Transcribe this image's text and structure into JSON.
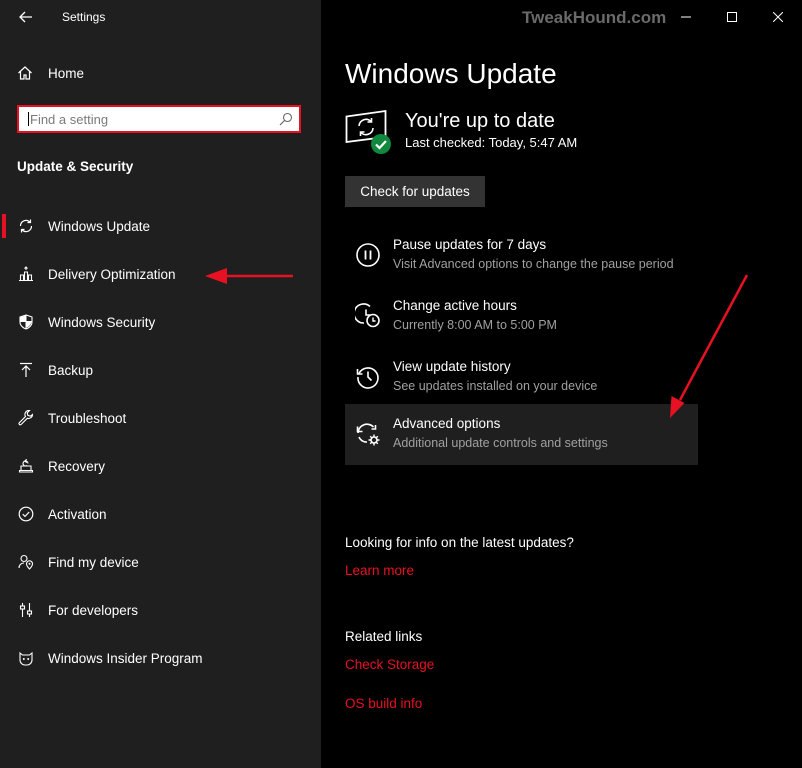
{
  "window": {
    "title": "Settings",
    "watermark": "TweakHound.com",
    "minimize_icon": "minimize-icon",
    "maximize_icon": "maximize-icon",
    "close_icon": "close-icon"
  },
  "sidebar": {
    "home_label": "Home",
    "search_placeholder": "Find a setting",
    "section_title": "Update & Security",
    "items": [
      {
        "label": "Windows Update",
        "icon": "sync-icon",
        "active": true
      },
      {
        "label": "Delivery Optimization",
        "icon": "delivery-optimization-icon"
      },
      {
        "label": "Windows Security",
        "icon": "shield-icon"
      },
      {
        "label": "Backup",
        "icon": "backup-arrow-icon"
      },
      {
        "label": "Troubleshoot",
        "icon": "wrench-icon"
      },
      {
        "label": "Recovery",
        "icon": "recovery-icon"
      },
      {
        "label": "Activation",
        "icon": "check-circle-icon"
      },
      {
        "label": "Find my device",
        "icon": "person-location-icon"
      },
      {
        "label": "For developers",
        "icon": "developer-sliders-icon"
      },
      {
        "label": "Windows Insider Program",
        "icon": "insider-cat-icon"
      }
    ]
  },
  "main": {
    "title": "Windows Update",
    "status_title": "You're up to date",
    "status_subtitle": "Last checked: Today, 5:47 AM",
    "check_button": "Check for updates",
    "options": [
      {
        "title": "Pause updates for 7 days",
        "subtitle": "Visit Advanced options to change the pause period",
        "icon": "pause-icon"
      },
      {
        "title": "Change active hours",
        "subtitle": "Currently 8:00 AM to 5:00 PM",
        "icon": "clock-icon"
      },
      {
        "title": "View update history",
        "subtitle": "See updates installed on your device",
        "icon": "history-icon"
      },
      {
        "title": "Advanced options",
        "subtitle": "Additional update controls and settings",
        "icon": "sync-gear-icon"
      }
    ],
    "info_question": "Looking for info on the latest updates?",
    "learn_more": "Learn more",
    "related_links_title": "Related links",
    "related_links": [
      "Check Storage",
      "OS build info"
    ]
  },
  "colors": {
    "accent": "#e81123",
    "sidebar_bg": "#1f1f1f",
    "main_bg": "#000000",
    "button_bg": "#333333"
  }
}
